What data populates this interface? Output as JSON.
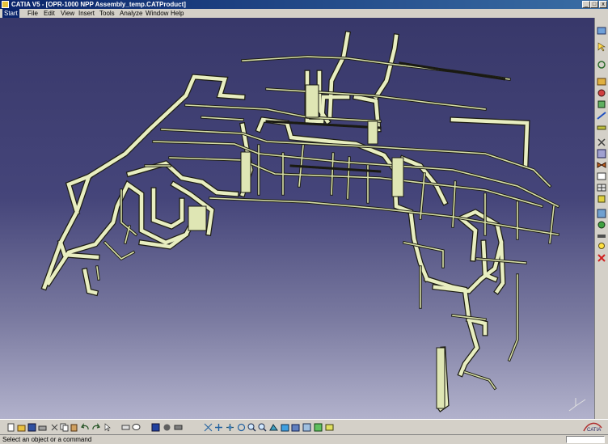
{
  "window": {
    "title": "CATIA V5 - [OPR-1000 NPP Assembly_temp.CATProduct]",
    "minimize_label": "_",
    "maximize_label": "□",
    "close_label": "x"
  },
  "menu": {
    "items": [
      "Start",
      "File",
      "Edit",
      "View",
      "Insert",
      "Tools",
      "Analyze",
      "Window",
      "Help"
    ]
  },
  "viewport": {
    "background_top": "#38386a",
    "background_bottom": "#b2b2cc",
    "pipe_color": "#e8eec0",
    "pipe_edge_color": "#1e1e14"
  },
  "compass": {
    "icon": "axis-triad-icon"
  },
  "logo": {
    "text": "CATIA"
  },
  "status": {
    "message": "Select an object or a command",
    "command_input_value": ""
  },
  "toolbars": {
    "right": [
      "product-icon",
      "select-icon",
      "rotate-icon",
      "catalog-icon",
      "paint-icon",
      "piping-icon",
      "line-icon",
      "run-icon",
      "cut-icon",
      "equipment-icon",
      "valve-icon",
      "analysis-icon",
      "table-icon",
      "attach-icon",
      "scene-icon",
      "hide-icon",
      "measure-icon",
      "light-icon",
      "delete-icon"
    ],
    "bottom": [
      "new-icon",
      "open-icon",
      "save-icon",
      "print-icon",
      "cut-icon",
      "copy-icon",
      "paste-icon",
      "undo-icon",
      "redo-icon",
      "whatsthis-icon",
      "select-icon",
      "graph-icon",
      "fog-icon",
      "comment-icon",
      "measure-icon",
      "render-icon",
      "hide-icon",
      "fit-all-icon",
      "pan-icon",
      "rotate-icon",
      "zoom-in-icon",
      "zoom-out-icon",
      "normal-view-icon",
      "iso-view-icon",
      "shading-icon",
      "hide-show-icon",
      "swap-icon",
      "layer-icon"
    ]
  }
}
